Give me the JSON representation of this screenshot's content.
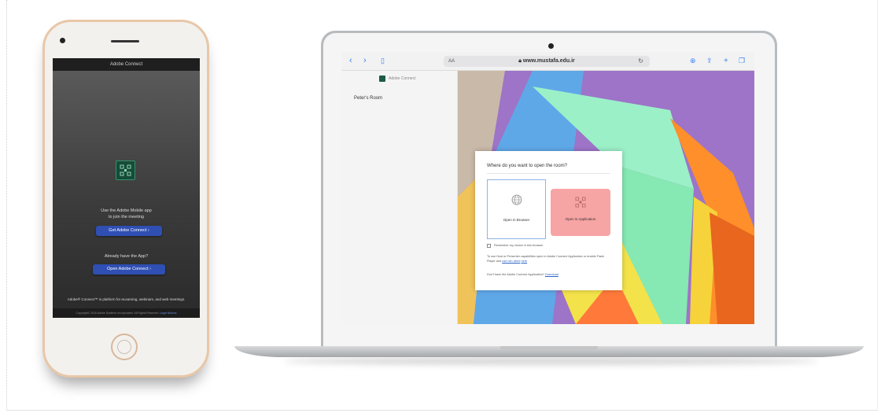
{
  "phone": {
    "topbar_title": "Adobe Connect",
    "line1": "Use the Adobe Mobile app",
    "line2": "to join the meeting",
    "get_button": "Get Adobe Connect",
    "already": "Already have the App?",
    "open_button": "Open Adobe Connect",
    "description": "Adobe® Connect™ is platform for eLearning, webinars, and web meetings.",
    "footer_text": "Copyright© 2016 Adobe Systems Incorporated. All Rights Reserved.",
    "footer_link": "Legal Notices"
  },
  "browser": {
    "url": "www.mustafa.edu.ir",
    "url_aa": "AA",
    "sidebar_brand": "Adobe Connect",
    "room_name": "Peter's Room"
  },
  "dialog": {
    "title": "Where do you want to open the room?",
    "option_browser": "Open in Browser",
    "option_application": "Open in Application",
    "remember": "Remember my choice in this browser",
    "info_part1": "To use Host or Presenter capabilities open in Adobe Connect Application or enable Flash Player and",
    "info_link": "use rich client",
    "info_part2": "here",
    "no_app": "Don't have the Adobe Connect Application?",
    "download_link": "Download"
  },
  "colors": {
    "phone_button": "#2f4fb3",
    "app_option": "#f7a4a4",
    "selected_border": "#8db4e8",
    "brand_green": "#1d5a44"
  }
}
